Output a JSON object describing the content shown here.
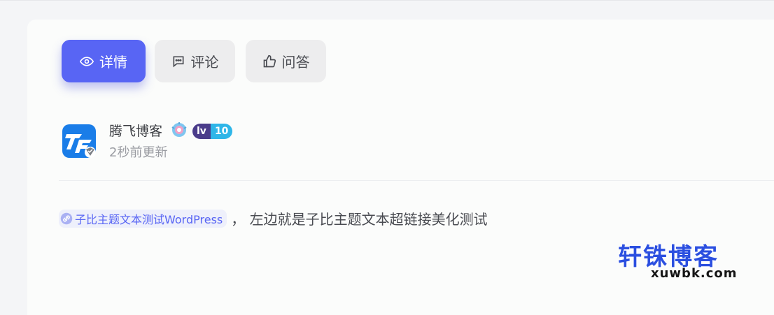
{
  "tabs": [
    {
      "label": "详情",
      "icon": "eye-icon",
      "active": true
    },
    {
      "label": "评论",
      "icon": "comment-icon",
      "active": false
    },
    {
      "label": "问答",
      "icon": "thumbs-up-icon",
      "active": false
    }
  ],
  "author": {
    "name": "腾飞博客",
    "level_prefix": "lv",
    "level_number": "10",
    "updated": "2秒前更新",
    "avatar_icon": "tf-logo-avatar",
    "verified_icon": "verified-badge-icon"
  },
  "content": {
    "link_text": "子比主题文本测试WordPress",
    "link_icon": "link-icon",
    "text": "，  左边就是子比主题文本超链接美化测试"
  },
  "watermark": {
    "title": "轩铢博客",
    "url": "xuwbk.com"
  },
  "colors": {
    "accent": "#5865f4",
    "tab_bg": "#ededee",
    "watermark": "#2b4fe0"
  }
}
